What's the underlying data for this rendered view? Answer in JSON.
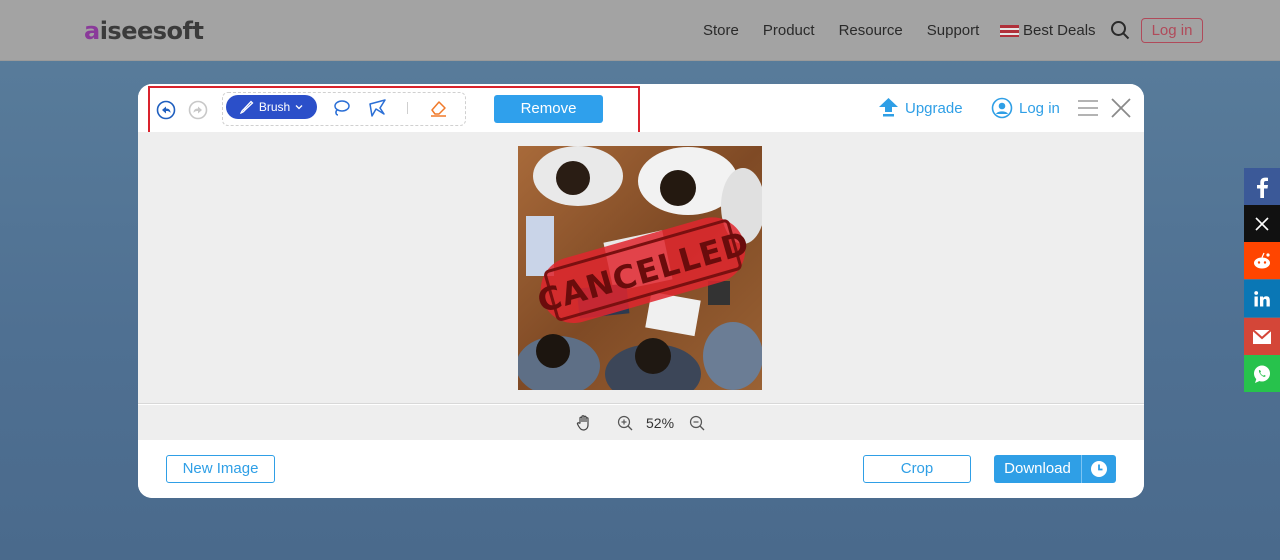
{
  "nav": {
    "logo_a": "a",
    "logo_rest": "iseesoft",
    "links": [
      "Store",
      "Product",
      "Resource",
      "Support"
    ],
    "best_deals": "Best Deals",
    "login": "Log in"
  },
  "modal": {
    "toolbar": {
      "brush_label": "Brush",
      "remove_label": "Remove",
      "upgrade_label": "Upgrade",
      "login_label": "Log in"
    },
    "image": {
      "stamp_text": "CANCELLED"
    },
    "zoom": {
      "value": "52%"
    },
    "footer": {
      "new_image_label": "New Image",
      "crop_label": "Crop",
      "download_label": "Download"
    }
  },
  "colors": {
    "accent": "#2f9fe6",
    "brush_active": "#2b4fc9",
    "highlight": "#d9232d",
    "stamp": "#e0262e"
  },
  "share": {
    "icons": [
      "facebook-icon",
      "x-icon",
      "reddit-icon",
      "linkedin-icon",
      "gmail-icon",
      "whatsapp-icon"
    ],
    "colors": [
      "#3b5998",
      "#111111",
      "#ff4500",
      "#0a77b5",
      "#d44638",
      "#27c24c"
    ]
  }
}
